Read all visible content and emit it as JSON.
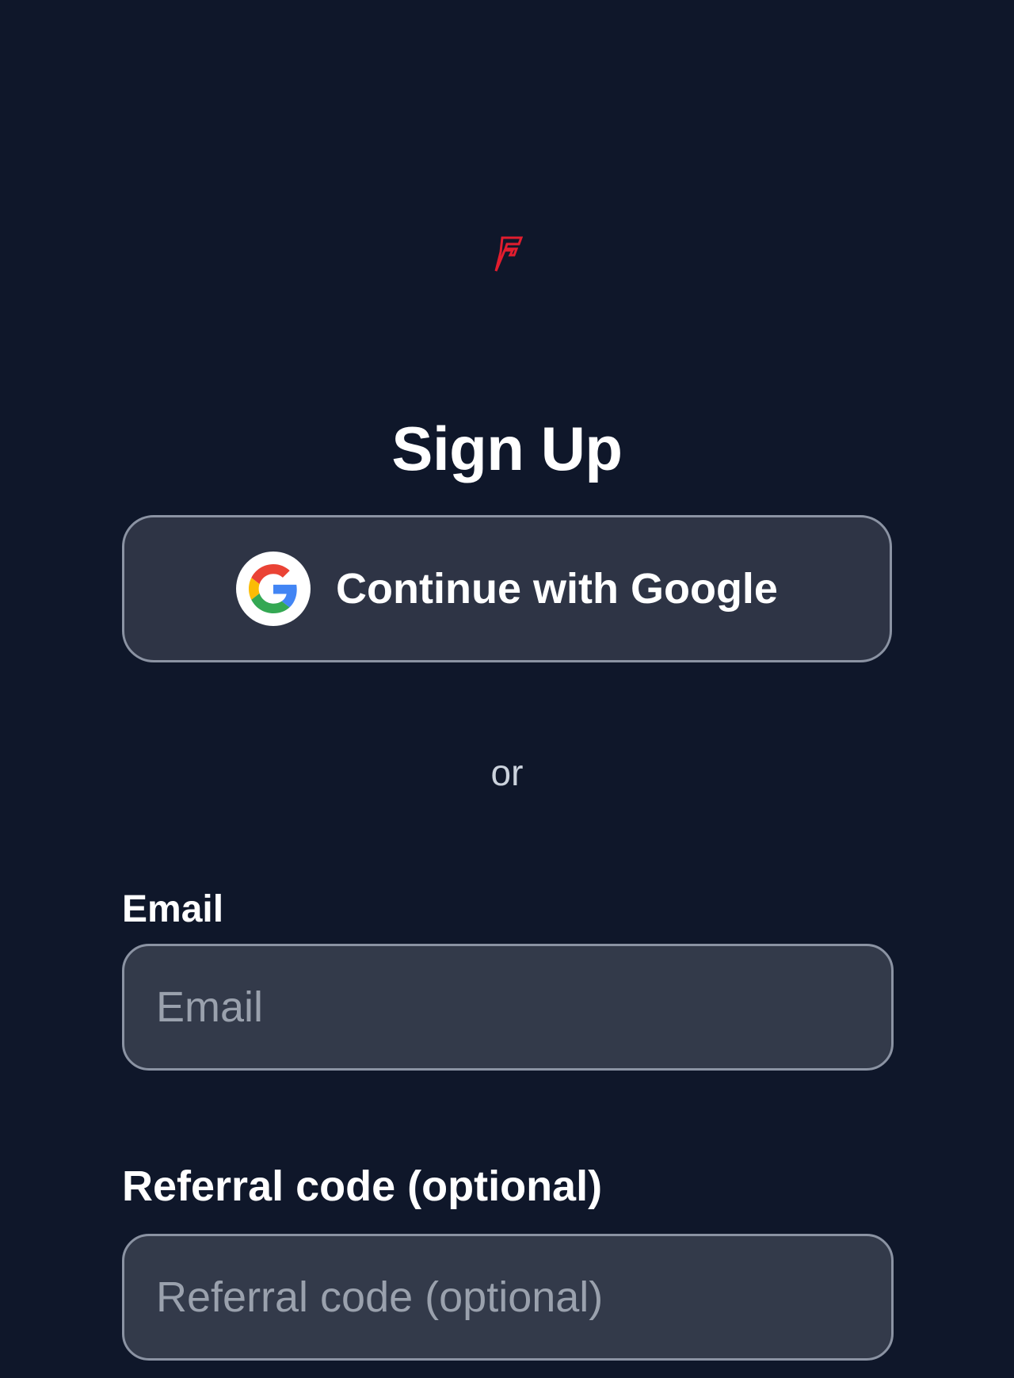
{
  "logo": {
    "icon": "f-logo-icon",
    "color": "#e11d2e"
  },
  "title": "Sign Up",
  "google_button": {
    "label": "Continue with Google",
    "icon": "google-icon"
  },
  "divider_text": "or",
  "form": {
    "email": {
      "label": "Email",
      "placeholder": "Email",
      "value": ""
    },
    "referral": {
      "label": "Referral code (optional)",
      "placeholder": "Referral code (optional)",
      "value": ""
    }
  },
  "colors": {
    "background": "#0f172a",
    "button_bg": "#2e3445",
    "input_bg": "#333a4a",
    "border": "#8b93a3",
    "accent": "#e11d2e"
  }
}
